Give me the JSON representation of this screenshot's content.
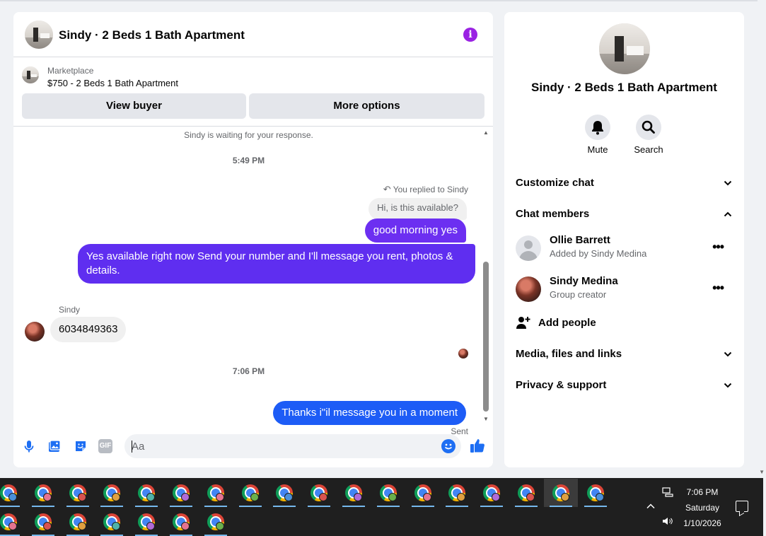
{
  "colors": {
    "accent_purple": "#6c2ff1",
    "accent_blue": "#1d5cf6",
    "info_purple": "#9a22e3",
    "icon_blue": "#1d6ef3"
  },
  "chat": {
    "title": "Sindy · 2 Beds 1 Bath Apartment",
    "info_icon": "info-icon",
    "marketplace": {
      "label": "Marketplace",
      "listing": "$750 - 2 Beds 1 Bath Apartment",
      "view_buyer": "View buyer",
      "more_options": "More options"
    },
    "messages": {
      "waiting": "Sindy is waiting for your response.",
      "time1": "5:49 PM",
      "reply_note": "You replied to Sindy",
      "quoted": "Hi, is this available?",
      "msg1": "good morning yes",
      "msg2": "Yes available right now Send your number and I'll message you rent, photos & details.",
      "sender": "Sindy",
      "incoming": "6034849363",
      "time2": "7:06 PM",
      "msg3": "Thanks i\"il message you in a moment",
      "status": "Sent"
    },
    "composer": {
      "placeholder": "Aa",
      "icons": [
        "microphone-icon",
        "image-icon",
        "sticker-icon",
        "gif-icon",
        "emoji-icon",
        "thumbs-up-icon"
      ],
      "gif_text": "GIF"
    }
  },
  "panel": {
    "title": "Sindy · 2 Beds 1 Bath Apartment",
    "mute": "Mute",
    "search": "Search",
    "customize": "Customize chat",
    "members_header": "Chat members",
    "members": [
      {
        "name": "Ollie Barrett",
        "sub": "Added by Sindy Medina"
      },
      {
        "name": "Sindy Medina",
        "sub": "Group creator"
      }
    ],
    "add_people": "Add people",
    "media": "Media, files and links",
    "privacy": "Privacy & support"
  },
  "taskbar": {
    "time": "7:06 PM",
    "day": "Saturday",
    "date": "1/10/2026",
    "app_icon": "chrome-icon"
  }
}
